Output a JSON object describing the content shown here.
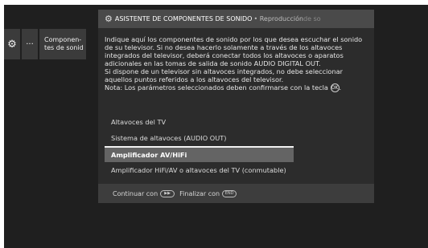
{
  "sidebar": {
    "gear_icon": "⚙",
    "dots": "···",
    "components_label": "Componen-\ntes de sonid"
  },
  "dialog": {
    "header_icon": "⚙",
    "title": "ASISTENTE DE COMPONENTES DE SONIDO",
    "subtitle": "• Reproducción",
    "subtitle_fade": "de so",
    "body": {
      "para1": "Indique aquí los componentes de sonido por los que desea escuchar el sonido de su televisor. Si no desea hacerlo solamente a través de los altavoces integrados del televisor, deberá conectar todos los altavoces o aparatos adicionales en las tomas de salida de sonido AUDIO DIGITAL OUT.",
      "para2": "Si dispone de un televisor sin altavoces integrados, no debe seleccionar aquellos puntos referidos a los altavoces del televisor.",
      "note": "Nota: Los parámetros seleccionados deben confirmarse con la tecla",
      "note_end": ".",
      "confirm_key": "OK"
    },
    "options": [
      {
        "label": "Altavoces del TV",
        "selected": false
      },
      {
        "label": "Sistema de altavoces (AUDIO OUT)",
        "selected": false
      },
      {
        "label": "Amplificador AV/HiFi",
        "selected": true
      },
      {
        "label": "Amplificador HiFi/AV o altavoces del TV (conmutable)",
        "selected": false
      }
    ],
    "footer": {
      "continue_label": "Continuar con",
      "continue_key": "▶▶",
      "finish_label": "Finalizar con",
      "finish_key": "END"
    }
  },
  "colors": {
    "background": "#1f1f1f",
    "header": "#4a4a4a",
    "panel": "#2c2c2c",
    "selected": "#646464"
  }
}
